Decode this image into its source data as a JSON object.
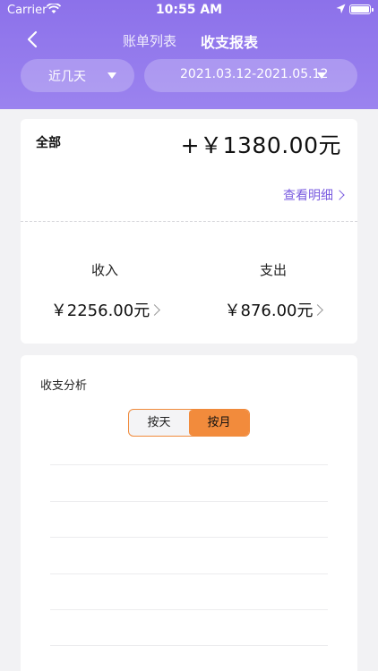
{
  "status_bar": {
    "carrier": "Carrier",
    "time": "10:55 AM"
  },
  "nav": {
    "tab_bill_list": "账单列表",
    "tab_report": "收支报表"
  },
  "filters": {
    "range_preset": "近几天",
    "date_range": "2021.03.12-2021.05.12"
  },
  "summary": {
    "total_label": "全部",
    "total_value": "+￥1380.00元",
    "detail_link": "查看明细",
    "income_label": "收入",
    "income_value": "￥2256.00元",
    "expense_label": "支出",
    "expense_value": "￥876.00元"
  },
  "analysis": {
    "title": "收支分析",
    "toggle": {
      "by_day": "按天",
      "by_month": "按月",
      "selected": "按月"
    }
  },
  "colors": {
    "header": "#8c71ea",
    "accent_orange": "#f28b3c",
    "link_purple": "#7a5ce0"
  }
}
